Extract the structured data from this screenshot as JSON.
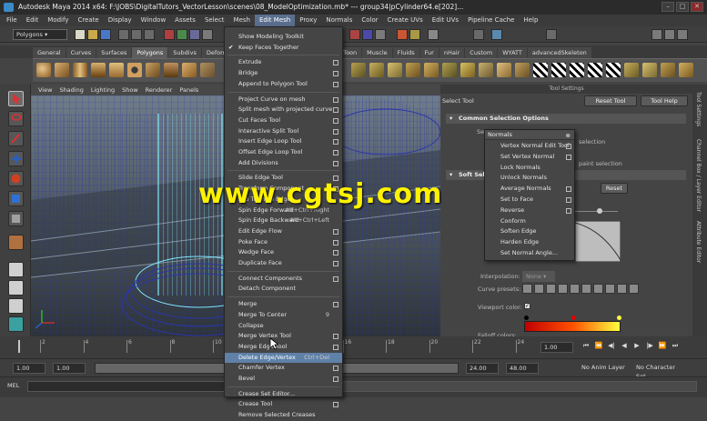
{
  "window": {
    "title": "Autodesk Maya 2014 x64: F:\\JOBS\\DigitalTutors_VectorLesson\\scenes\\08_ModelOptimization.mb*   ---   group34|pCylinder64.e[202]..."
  },
  "menubar": [
    "File",
    "Edit",
    "Modify",
    "Create",
    "Display",
    "Window",
    "Assets",
    "Select",
    "Mesh",
    "Edit Mesh",
    "Proxy",
    "Normals",
    "Color",
    "Create UVs",
    "Edit UVs",
    "Pipeline Cache",
    "Help"
  ],
  "status_line": {
    "mode": "Polygons"
  },
  "shelf_tabs": [
    "General",
    "Curves",
    "Surfaces",
    "Polygons",
    "Subdivs",
    "Deform",
    "",
    "",
    "",
    "",
    "",
    "",
    "PaintEffects",
    "Toon",
    "Muscle",
    "Fluids",
    "Fur",
    "nHair",
    "Custom",
    "WYATT",
    "advancedSkeleton"
  ],
  "viewport_menu": [
    "View",
    "Shading",
    "Lighting",
    "Show",
    "Renderer",
    "Panels"
  ],
  "edit_mesh_menu": [
    {
      "label": "Show Modeling Toolkit",
      "box": false
    },
    {
      "label": "Keep Faces Together",
      "check": true,
      "box": false
    },
    {
      "sep": true
    },
    {
      "label": "Extrude",
      "box": true
    },
    {
      "label": "Bridge",
      "box": true
    },
    {
      "label": "Append to Polygon Tool",
      "box": true
    },
    {
      "sep": true
    },
    {
      "label": "Project Curve on mesh",
      "box": true
    },
    {
      "label": "Split mesh with projected curve",
      "box": true
    },
    {
      "label": "Cut Faces Tool",
      "box": true
    },
    {
      "label": "Interactive Split Tool",
      "box": true
    },
    {
      "label": "Insert Edge Loop Tool",
      "box": true
    },
    {
      "label": "Offset Edge Loop Tool",
      "box": true
    },
    {
      "label": "Add Divisions",
      "box": true
    },
    {
      "sep": true
    },
    {
      "label": "Slide Edge Tool",
      "box": true
    },
    {
      "label": "Transform Component",
      "box": true
    },
    {
      "label": "Flip Triangle Edge",
      "box": false
    },
    {
      "label": "Spin Edge Forward",
      "shortcut": "Alt+Ctrl+Right",
      "box": false
    },
    {
      "label": "Spin Edge Backward",
      "shortcut": "Alt+Ctrl+Left",
      "box": false
    },
    {
      "label": "Edit Edge Flow",
      "box": true
    },
    {
      "label": "Poke Face",
      "box": true
    },
    {
      "label": "Wedge Face",
      "box": true
    },
    {
      "label": "Duplicate Face",
      "box": true
    },
    {
      "sep": true
    },
    {
      "label": "Connect Components",
      "box": true
    },
    {
      "label": "Detach Component",
      "box": false
    },
    {
      "sep": true
    },
    {
      "label": "Merge",
      "box": true
    },
    {
      "label": "Merge To Center",
      "shortcut": "9",
      "box": false
    },
    {
      "label": "Collapse",
      "box": false
    },
    {
      "label": "Merge Vertex Tool",
      "box": true
    },
    {
      "label": "Merge Edge Tool",
      "box": true
    },
    {
      "label": "Delete Edge/Vertex",
      "shortcut": "Ctrl+Del",
      "box": false,
      "hl": true
    },
    {
      "label": "Chamfer Vertex",
      "box": true
    },
    {
      "label": "Bevel",
      "box": true
    },
    {
      "sep": true
    },
    {
      "label": "Crease Set Editor...",
      "box": false
    },
    {
      "label": "Crease Tool",
      "box": true
    },
    {
      "label": "Remove Selected Creases",
      "box": false
    }
  ],
  "normals_menu": {
    "title": "Normals",
    "items": [
      {
        "label": "Vertex Normal Edit Tool",
        "box": true
      },
      {
        "label": "Set Vertex Normal",
        "box": true
      },
      {
        "label": "Lock Normals",
        "box": false
      },
      {
        "label": "Unlock Normals",
        "box": false
      },
      {
        "label": "Average Normals",
        "box": true
      },
      {
        "label": "Set to Face",
        "box": true
      },
      {
        "label": "Reverse",
        "box": true
      },
      {
        "label": "Conform",
        "box": false
      },
      {
        "label": "Soften Edge",
        "box": false
      },
      {
        "label": "Harden Edge",
        "box": false
      },
      {
        "label": "Set Normal Angle...",
        "box": false
      }
    ]
  },
  "tool_settings": {
    "header": "Tool Settings",
    "tool_name": "Select Tool",
    "reset_tool": "Reset Tool",
    "tool_help": "Tool Help",
    "common_selection": "Common Selection Options",
    "selection_text_1": "selection",
    "selection_text_2": "paint selection",
    "soft_select": "Soft Select",
    "reset": "Reset",
    "interpolation_label": "Interpolation:",
    "interpolation_value": "None",
    "curve_presets": "Curve presets:",
    "viewport_color": "Viewport color:",
    "falloff_colors": "Falloff colors:"
  },
  "side_tabs": [
    "Tool Settings",
    "Channel Box / Layer Editor",
    "Attribute Editor"
  ],
  "time_slider": {
    "ticks": [
      "2",
      "4",
      "6",
      "8",
      "10",
      "12",
      "14",
      "16",
      "18",
      "20",
      "22",
      "24"
    ],
    "current": "1.00"
  },
  "range": {
    "start": "1.00",
    "start2": "1.00",
    "end": "24.00",
    "end2": "48.00",
    "anim_layer": "No Anim Layer",
    "character": "No Character Set"
  },
  "mel": {
    "label": "MEL"
  },
  "watermark": "www.cgtsj.com",
  "colors": {
    "accent": "#5f81a8",
    "wire_blue": "#2b36a8",
    "wire_cyan": "#7fe8ff",
    "watermark": "#fff200"
  }
}
